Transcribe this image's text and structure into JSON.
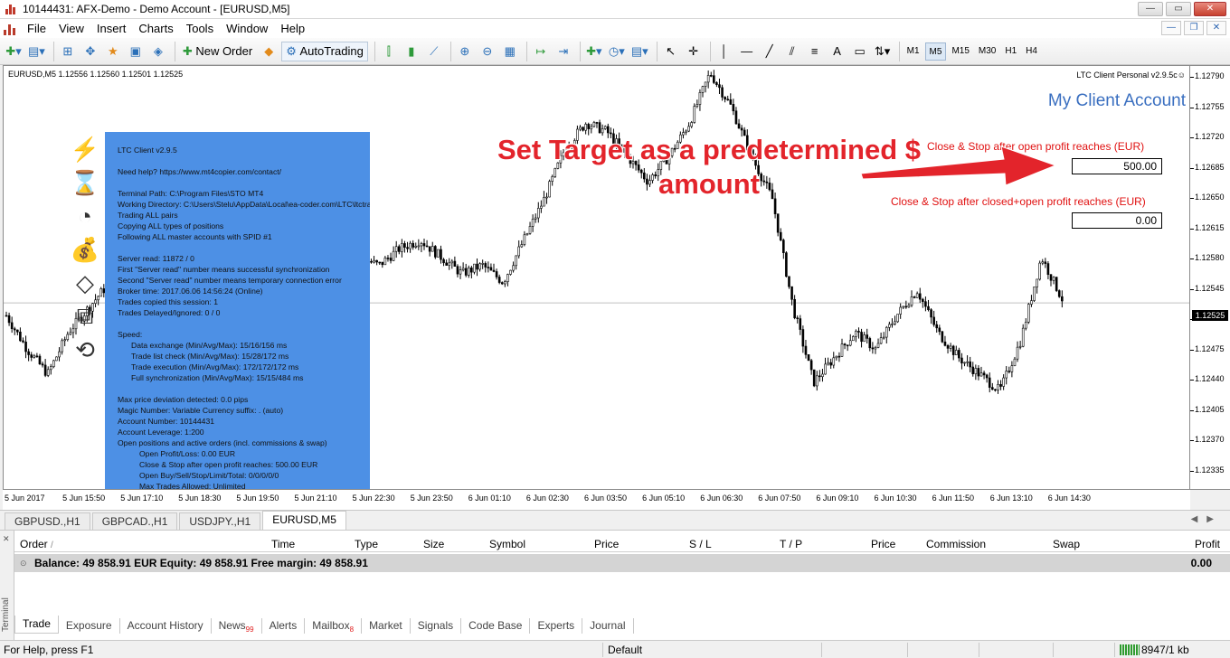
{
  "window": {
    "title": "10144431: AFX-Demo - Demo Account - [EURUSD,M5]"
  },
  "menu": [
    "File",
    "View",
    "Insert",
    "Charts",
    "Tools",
    "Window",
    "Help"
  ],
  "toolbar": {
    "new_order": "New Order",
    "autotrading": "AutoTrading",
    "timeframes": [
      "M1",
      "M5",
      "M15",
      "M30",
      "H1",
      "H4"
    ],
    "active_timeframe": "M5"
  },
  "chart": {
    "info": "EURUSD,M5  1.12556 1.12560 1.12501 1.12525",
    "ltc_version": "LTC Client Personal v2.9.5c☺",
    "account_title": "My Client Account",
    "close_open_label": "Close & Stop after open profit reaches (EUR)",
    "close_open_value": "500.00",
    "close_closed_label": "Close & Stop after closed+open profit reaches (EUR)",
    "close_closed_value": "0.00",
    "annotation": "Set Target as a predetermined $ amount",
    "price_labels": [
      "1.12790",
      "1.12755",
      "1.12720",
      "1.12685",
      "1.12650",
      "1.12615",
      "1.12580",
      "1.12545",
      "1.12510",
      "1.12475",
      "1.12440",
      "1.12405",
      "1.12370",
      "1.12335"
    ],
    "current_price": "1.12525",
    "time_labels": [
      "5 Jun 2017",
      "5 Jun 15:50",
      "5 Jun 17:10",
      "5 Jun 18:30",
      "5 Jun 19:50",
      "5 Jun 21:10",
      "5 Jun 22:30",
      "5 Jun 23:50",
      "6 Jun 01:10",
      "6 Jun 02:30",
      "6 Jun 03:50",
      "6 Jun 05:10",
      "6 Jun 06:30",
      "6 Jun 07:50",
      "6 Jun 09:10",
      "6 Jun 10:30",
      "6 Jun 11:50",
      "6 Jun 13:10",
      "6 Jun 14:30"
    ]
  },
  "chart_data": {
    "type": "candlestick",
    "symbol": "EURUSD",
    "timeframe": "M5",
    "ylim": [
      1.12325,
      1.12795
    ],
    "close_series": [
      1.1251,
      1.1247,
      1.1244,
      1.1249,
      1.1252,
      1.1255,
      1.125,
      1.1246,
      1.1253,
      1.1257,
      1.1254,
      1.1256,
      1.1258,
      1.1255,
      1.1257,
      1.1259,
      1.1256,
      1.1258,
      1.1257,
      1.1259,
      1.126,
      1.1258,
      1.1256,
      1.1257,
      1.1255,
      1.126,
      1.1265,
      1.1271,
      1.1274,
      1.1273,
      1.127,
      1.1267,
      1.127,
      1.1274,
      1.128,
      1.1276,
      1.127,
      1.1265,
      1.1252,
      1.1243,
      1.1246,
      1.1249,
      1.1247,
      1.1251,
      1.1254,
      1.1249,
      1.1246,
      1.1244,
      1.1242,
      1.1248,
      1.1258,
      1.1253
    ]
  },
  "ltc_panel": {
    "lines": [
      "LTC Client v2.9.5",
      "",
      "Need help? https://www.mt4copier.com/contact/",
      "",
      "Terminal Path: C:\\Program Files\\STO MT4",
      "Working Directory: C:\\Users\\Stelu\\AppData\\Local\\ea-coder.com\\LTC\\ltctrades\\",
      "Trading ALL pairs",
      "Copying ALL types of positions",
      "Following ALL master accounts with SPID #1",
      "",
      "Server read: 11872 / 0",
      "First \"Server read\" number means successful synchronization",
      "Second \"Server read\" number means temporary connection error",
      "Broker time: 2017.06.06 14:56:24 (Online)",
      "Trades copied this session: 1",
      "Trades Delayed/Ignored: 0 / 0",
      "",
      "Speed:",
      ">Data exchange (Min/Avg/Max): 15/16/156 ms",
      ">Trade list check (Min/Avg/Max): 15/28/172 ms",
      ">Trade execution (Min/Avg/Max): 172/172/172 ms",
      ">Full synchronization (Min/Avg/Max): 15/15/484 ms",
      "",
      "Max price deviation detected: 0.0 pips",
      "Magic Number: Variable      Currency suffix: . (auto)",
      "Account Number: 10144431",
      "Account Leverage: 1:200",
      "Open positions and active orders (incl. commissions & swap)",
      ">>Open Profit/Loss: 0.00 EUR",
      ">>Close & Stop after open profit reaches: 500.00 EUR",
      ">>Open Buy/Sell/Stop/Limit/Total: 0/0/0/0/0",
      ">>Max Trades Allowed: Unlimited"
    ]
  },
  "chart_tabs": [
    "GBPUSD.,H1",
    "GBPCAD.,H1",
    "USDJPY.,H1",
    "EURUSD,M5"
  ],
  "active_chart_tab": "EURUSD,M5",
  "terminal": {
    "side_label": "Terminal",
    "columns": [
      "Order",
      "Time",
      "Type",
      "Size",
      "Symbol",
      "Price",
      "S / L",
      "T / P",
      "Price",
      "Commission",
      "Swap",
      "Profit"
    ],
    "balance": "Balance: 49 858.91 EUR  Equity: 49 858.91  Free margin: 49 858.91",
    "balance_profit": "0.00",
    "tabs": [
      {
        "label": "Trade",
        "badge": ""
      },
      {
        "label": "Exposure",
        "badge": ""
      },
      {
        "label": "Account History",
        "badge": ""
      },
      {
        "label": "News",
        "badge": "99"
      },
      {
        "label": "Alerts",
        "badge": ""
      },
      {
        "label": "Mailbox",
        "badge": "8"
      },
      {
        "label": "Market",
        "badge": ""
      },
      {
        "label": "Signals",
        "badge": ""
      },
      {
        "label": "Code Base",
        "badge": ""
      },
      {
        "label": "Experts",
        "badge": ""
      },
      {
        "label": "Journal",
        "badge": ""
      }
    ]
  },
  "status": {
    "help": "For Help, press F1",
    "profile": "Default",
    "traffic": "8947/1 kb"
  },
  "colors": {
    "panel": "#4d90e5",
    "annotation": "#e3242b",
    "account_title": "#3a6fc0"
  }
}
